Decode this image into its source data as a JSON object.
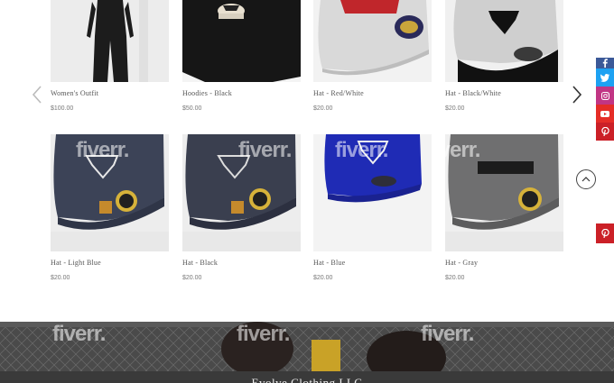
{
  "products_row1": [
    {
      "name": "Women's Outfit",
      "price": "$100.00"
    },
    {
      "name": "Hoodies - Black",
      "price": "$50.00"
    },
    {
      "name": "Hat - Red/White",
      "price": "$20.00"
    },
    {
      "name": "Hat - Black/White",
      "price": "$20.00"
    }
  ],
  "products_row2": [
    {
      "name": "Hat - Light Blue",
      "price": "$20.00"
    },
    {
      "name": "Hat - Black",
      "price": "$20.00"
    },
    {
      "name": "Hat - Blue",
      "price": "$20.00"
    },
    {
      "name": "Hat - Gray",
      "price": "$20.00"
    }
  ],
  "watermark": "fiverr.",
  "social_icons": [
    "facebook-icon",
    "twitter-icon",
    "instagram-icon",
    "youtube-icon",
    "pinterest-icon"
  ],
  "footer": {
    "brand": "Evolve Clothing LLC"
  },
  "colors": {
    "facebook": "#3b5998",
    "twitter": "#1da1f2",
    "instagram": "#c13584",
    "youtube": "#e52d27",
    "pinterest": "#cb2027"
  }
}
